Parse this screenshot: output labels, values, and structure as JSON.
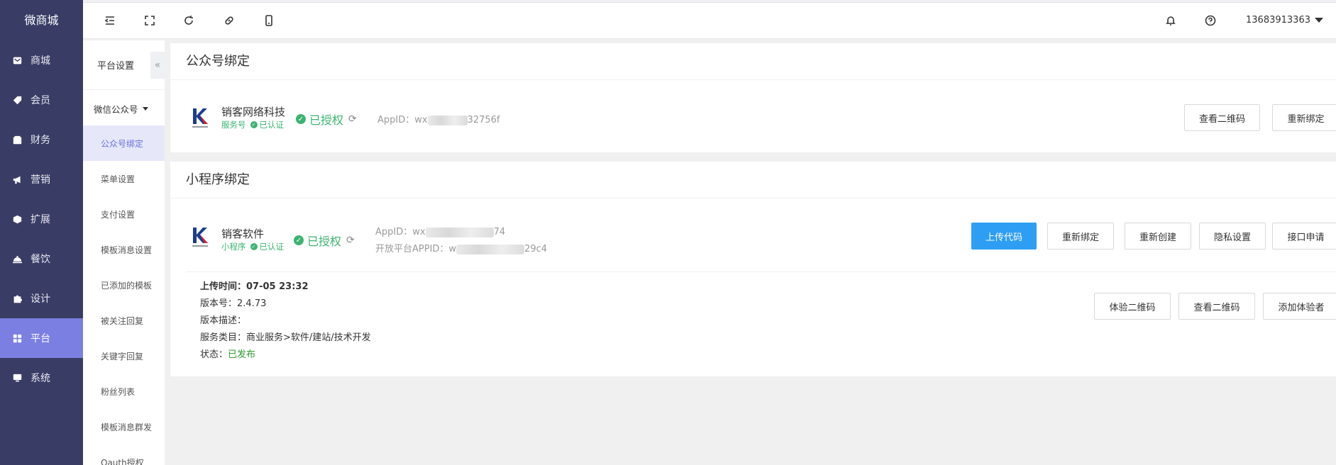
{
  "sidebar": {
    "brand": "微商城",
    "items": [
      {
        "label": "商城",
        "icon": "mail-icon"
      },
      {
        "label": "会员",
        "icon": "tag-icon"
      },
      {
        "label": "财务",
        "icon": "wallet-icon"
      },
      {
        "label": "营销",
        "icon": "megaphone-icon"
      },
      {
        "label": "扩展",
        "icon": "cube-icon"
      },
      {
        "label": "餐饮",
        "icon": "cloche-icon"
      },
      {
        "label": "设计",
        "icon": "puzzle-icon"
      },
      {
        "label": "平台",
        "icon": "grid-icon"
      },
      {
        "label": "系统",
        "icon": "monitor-icon"
      }
    ],
    "active_index": 7
  },
  "subnav": {
    "title": "平台设置",
    "group": "微信公众号",
    "items": [
      "公众号绑定",
      "菜单设置",
      "支付设置",
      "模板消息设置",
      "已添加的模板",
      "被关注回复",
      "关键字回复",
      "粉丝列表",
      "模板消息群发",
      "Oauth授权"
    ],
    "active_index": 0
  },
  "topbar": {
    "user": "13683913363"
  },
  "official_account": {
    "section_title": "公众号绑定",
    "name": "销客网络科技",
    "type": "服务号",
    "verified": "已认证",
    "status": "已授权",
    "appid_label": "AppID：",
    "appid_prefix": "wx",
    "appid_suffix": "32756f",
    "buttons": {
      "view_qr": "查看二维码",
      "rebind": "重新绑定"
    }
  },
  "mini_program": {
    "section_title": "小程序绑定",
    "name": "销客软件",
    "type": "小程序",
    "verified": "已认证",
    "status": "已授权",
    "appid_label": "AppID：",
    "appid_prefix": "wx",
    "appid_suffix": "74",
    "open_appid_label": "开放平台APPID：",
    "open_appid_prefix": "w",
    "open_appid_suffix": "29c4",
    "buttons": {
      "upload": "上传代码",
      "rebind": "重新绑定",
      "recreate": "重新创建",
      "privacy": "隐私设置",
      "api": "接口申请"
    },
    "version": {
      "upload_time_label": "上传时间：",
      "upload_time": "07-05 23:32",
      "version_label": "版本号：",
      "version": "2.4.73",
      "desc_label": "版本描述：",
      "category_label": "服务类目：",
      "category": "商业服务>软件/建站/技术开发",
      "status_label": "状态：",
      "status": "已发布"
    },
    "version_buttons": {
      "trial_qr": "体验二维码",
      "view_qr": "查看二维码",
      "add_tester": "添加体验者"
    }
  }
}
